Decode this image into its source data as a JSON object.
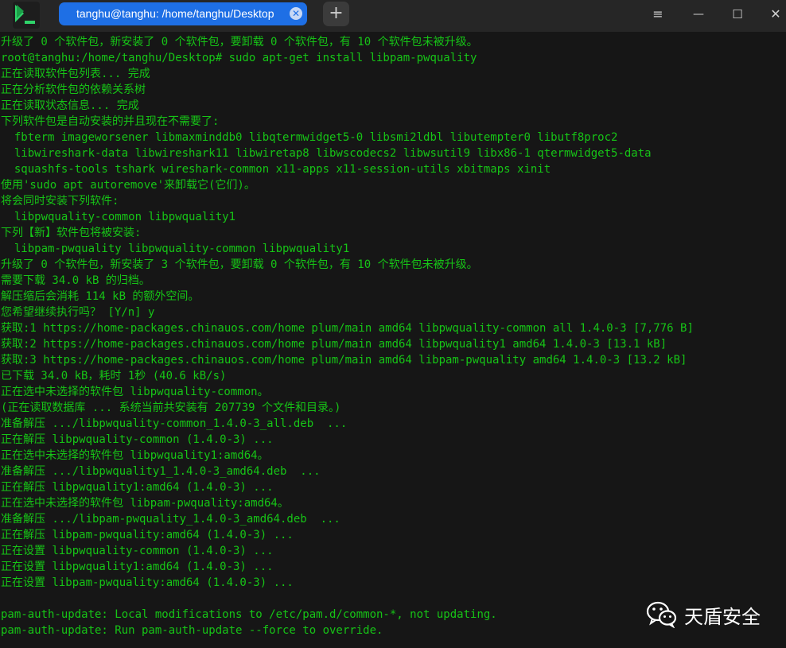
{
  "window": {
    "tab_title": "tanghu@tanghu: /home/tanghu/Desktop",
    "tab_close_icon": "close-icon",
    "new_tab_label": "+",
    "menu_icon": "≡",
    "minimize_icon": "—",
    "maximize_icon": "☐",
    "close_icon": "✕"
  },
  "terminal": {
    "lines": [
      "升级了 0 个软件包，新安装了 0 个软件包，要卸载 0 个软件包，有 10 个软件包未被升级。",
      "root@tanghu:/home/tanghu/Desktop# sudo apt-get install libpam-pwquality",
      "正在读取软件包列表... 完成",
      "正在分析软件包的依赖关系树",
      "正在读取状态信息... 完成",
      "下列软件包是自动安装的并且现在不需要了:",
      "  fbterm imageworsener libmaxminddb0 libqtermwidget5-0 libsmi2ldbl libutempter0 libutf8proc2",
      "  libwireshark-data libwireshark11 libwiretap8 libwscodecs2 libwsutil9 libx86-1 qtermwidget5-data",
      "  squashfs-tools tshark wireshark-common x11-apps x11-session-utils xbitmaps xinit",
      "使用'sudo apt autoremove'来卸载它(它们)。",
      "将会同时安装下列软件:",
      "  libpwquality-common libpwquality1",
      "下列【新】软件包将被安装:",
      "  libpam-pwquality libpwquality-common libpwquality1",
      "升级了 0 个软件包，新安装了 3 个软件包，要卸载 0 个软件包，有 10 个软件包未被升级。",
      "需要下载 34.0 kB 的归档。",
      "解压缩后会消耗 114 kB 的额外空间。",
      "您希望继续执行吗？ [Y/n] y",
      "获取:1 https://home-packages.chinauos.com/home plum/main amd64 libpwquality-common all 1.4.0-3 [7,776 B]",
      "获取:2 https://home-packages.chinauos.com/home plum/main amd64 libpwquality1 amd64 1.4.0-3 [13.1 kB]",
      "获取:3 https://home-packages.chinauos.com/home plum/main amd64 libpam-pwquality amd64 1.4.0-3 [13.2 kB]",
      "已下载 34.0 kB，耗时 1秒 (40.6 kB/s)",
      "正在选中未选择的软件包 libpwquality-common。",
      "(正在读取数据库 ... 系统当前共安装有 207739 个文件和目录。)",
      "准备解压 .../libpwquality-common_1.4.0-3_all.deb  ...",
      "正在解压 libpwquality-common (1.4.0-3) ...",
      "正在选中未选择的软件包 libpwquality1:amd64。",
      "准备解压 .../libpwquality1_1.4.0-3_amd64.deb  ...",
      "正在解压 libpwquality1:amd64 (1.4.0-3) ...",
      "正在选中未选择的软件包 libpam-pwquality:amd64。",
      "准备解压 .../libpam-pwquality_1.4.0-3_amd64.deb  ...",
      "正在解压 libpam-pwquality:amd64 (1.4.0-3) ...",
      "正在设置 libpwquality-common (1.4.0-3) ...",
      "正在设置 libpwquality1:amd64 (1.4.0-3) ...",
      "正在设置 libpam-pwquality:amd64 (1.4.0-3) ...",
      "",
      "pam-auth-update: Local modifications to /etc/pam.d/common-*, not updating.",
      "pam-auth-update: Run pam-auth-update --force to override."
    ]
  },
  "watermark": {
    "text": "天盾安全",
    "icon": "wechat-icon"
  },
  "colors": {
    "background": "#161616",
    "text_green": "#16c416",
    "tab_blue": "#1e6fe5"
  }
}
